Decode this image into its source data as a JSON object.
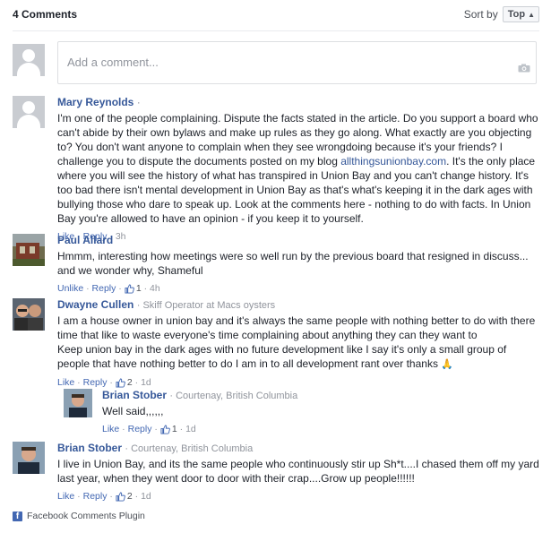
{
  "header": {
    "comment_count": "4 Comments",
    "sort_label": "Sort by",
    "sort_value": "Top"
  },
  "compose": {
    "placeholder": "Add a comment...",
    "icon": "camera-icon"
  },
  "comments": [
    {
      "name": "Mary Reynolds",
      "descriptor": "",
      "text_parts": [
        "I'm one of the people complaining. Dispute the facts stated in the article. Do you support a board who can't abide by their own bylaws and make up rules as they go along. What exactly are you objecting to? You don't want anyone to complain when they see wrongdoing because it's your friends? I challenge you to dispute the documents posted on my blog ",
        "allthingsunionbay.com",
        ". It's the only place where you will see the history of what has transpired in Union Bay and you can't change history. It's too bad there isn't mental development in Union Bay as that's what's keeping it in the dark ages with bullying those who dare to speak up. Look at the comments here - nothing to do with facts. In Union Bay you're allowed to have an opinion - if you keep it to yourself."
      ],
      "like_label": "Like",
      "reply_label": "Reply",
      "likes": "",
      "time": "3h"
    },
    {
      "name": "Paul Allard",
      "descriptor": "",
      "text": "Hmmm, interesting how meetings were so well run by the previous board that resigned in discuss... and we wonder why, Shameful",
      "like_label": "Unlike",
      "reply_label": "Reply",
      "likes": "1",
      "time": "4h"
    },
    {
      "name": "Dwayne Cullen",
      "descriptor": "Skiff Operator at Macs oysters",
      "text_lines": [
        "I am a house owner in union bay and it's always the same people with nothing better to do with there time that like to waste everyone's time complaining about anything they can they want to",
        "Keep union bay in the dark ages with no future development like I say it's only a small group of people that have nothing better to do I am in to all development rant over thanks"
      ],
      "like_label": "Like",
      "reply_label": "Reply",
      "likes": "2",
      "time": "1d",
      "reply": {
        "name": "Brian Stober",
        "descriptor": "Courtenay, British Columbia",
        "text": "Well said,,,,,,",
        "like_label": "Like",
        "reply_label": "Reply",
        "likes": "1",
        "time": "1d"
      }
    },
    {
      "name": "Brian Stober",
      "descriptor": "Courtenay, British Columbia",
      "text": "I live in Union Bay, and its the same people who continuously stir up Sh*t....I chased them off my yard last year, when they went door to door with their crap....Grow up people!!!!!!",
      "like_label": "Like",
      "reply_label": "Reply",
      "likes": "2",
      "time": "1d"
    }
  ],
  "footer": {
    "label": "Facebook Comments Plugin"
  },
  "colors": {
    "link": "#365899",
    "action": "#4267b2",
    "muted": "#90949c",
    "text": "#1d2129",
    "placeholder_avatar": "#c9ccd1"
  }
}
